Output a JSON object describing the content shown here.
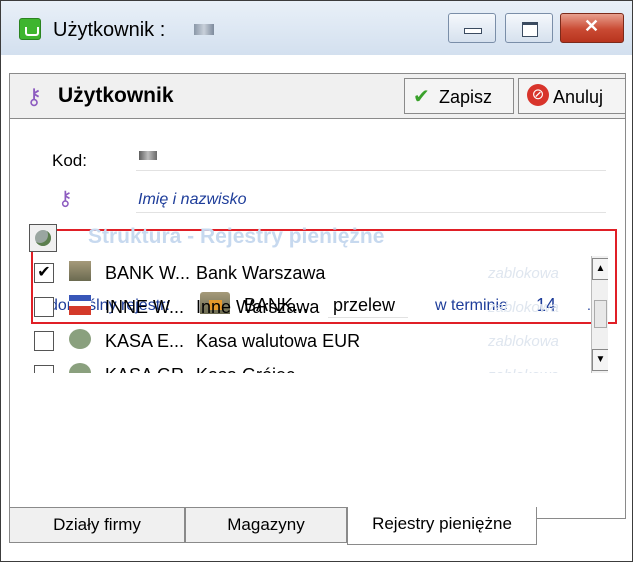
{
  "window": {
    "title": "Użytkownik :"
  },
  "toolbar": {
    "title": "Użytkownik",
    "save_label": "Zapisz",
    "cancel_label": "Anuluj"
  },
  "form": {
    "kod_label": "Kod:",
    "name_placeholder": "Imię i nazwisko",
    "default_register_label": "domyślny rejestr:",
    "default_register_code": "BANK...",
    "default_register_method": "przelew",
    "term_label": "w terminie",
    "term_days": "14",
    "more_label": "..."
  },
  "registers": {
    "title": "Struktura - Rejestry pieniężne",
    "rows": [
      {
        "checked": true,
        "icon": "bank-icon",
        "code": "BANK W...",
        "name": "Bank Warszawa",
        "status": "zablokowa"
      },
      {
        "checked": false,
        "icon": "flag-icon",
        "code": "INNE W...",
        "name": "Inne Warszawa",
        "status": "zablokowa"
      },
      {
        "checked": false,
        "icon": "cash-icon",
        "code": "KASA E...",
        "name": "Kasa walutowa EUR",
        "status": "zablokowa"
      },
      {
        "checked": false,
        "icon": "cash-icon",
        "code": "KASA GR...",
        "name": "Kasa Grójec",
        "status": "zablokowa"
      }
    ],
    "check_mark": "✔"
  },
  "tabs": [
    {
      "label": "Działy firmy"
    },
    {
      "label": "Magazyny"
    },
    {
      "label": "Rejestry pieniężne",
      "active": true
    }
  ]
}
